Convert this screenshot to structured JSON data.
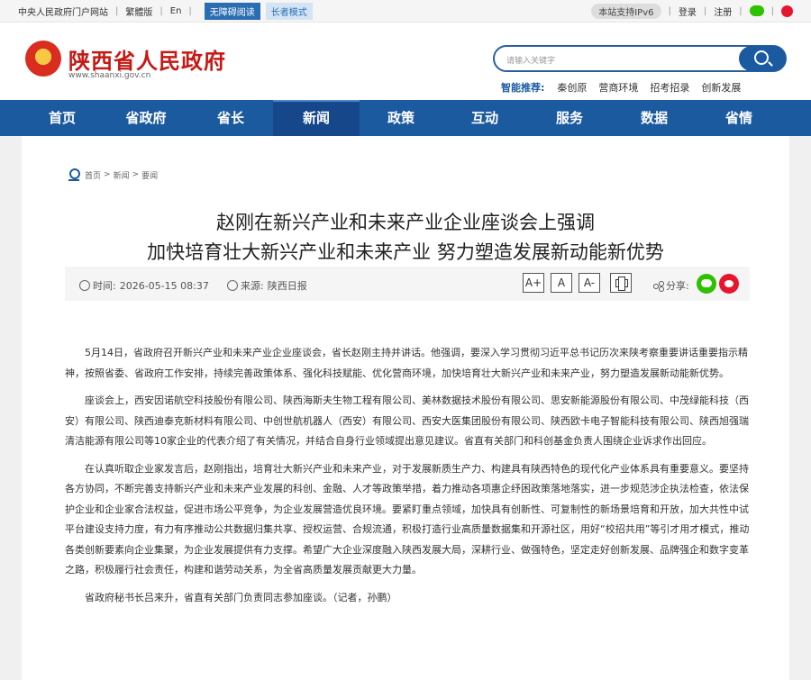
{
  "topbar": {
    "links": [
      "中央人民政府门户网站",
      "繁體版",
      "En"
    ],
    "accessible": "无障碍阅读",
    "elder": "长者模式",
    "ipv6": "本站支持IPv6",
    "login": "登录",
    "register": "注册"
  },
  "header": {
    "title": "陕西省人民政府",
    "url": "www.shaanxi.gov.cn",
    "search_placeholder": "请输入关键字",
    "smart_label": "智能推荐:",
    "smart_items": [
      "秦创原",
      "营商环境",
      "招考招录",
      "创新发展"
    ]
  },
  "nav": [
    "首页",
    "省政府",
    "省长",
    "新闻",
    "政策",
    "互动",
    "服务",
    "数据",
    "省情"
  ],
  "breadcrumb": [
    "首页",
    "新闻",
    "要闻"
  ],
  "article": {
    "title_line1": "赵刚在新兴产业和未来产业企业座谈会上强调",
    "title_line2": "加快培育壮大新兴产业和未来产业 努力塑造发展新动能新优势",
    "time_label": "时间:",
    "time": "2026-05-15 08:37",
    "source_label": "来源:",
    "source": "陕西日报",
    "font_buttons": [
      "A+",
      "A",
      "A-"
    ],
    "share_label": "分享:",
    "paragraphs": [
      "5月14日，省政府召开新兴产业和未来产业企业座谈会，省长赵刚主持并讲话。他强调，要深入学习贯彻习近平总书记历次来陕考察重要讲话重要指示精神，按照省委、省政府工作安排，持续完善政策体系、强化科技赋能、优化营商环境，加快培育壮大新兴产业和未来产业，努力塑造发展新动能新优势。",
      "座谈会上，西安因诺航空科技股份有限公司、陕西海斯夫生物工程有限公司、美林数据技术股份有限公司、思安新能源股份有限公司、中茂绿能科技（西安）有限公司、陕西迪泰克新材料有限公司、中创世航机器人（西安）有限公司、西安大医集团股份有限公司、陕西欧卡电子智能科技有限公司、陕西旭强瑞清洁能源有限公司等10家企业的代表介绍了有关情况，并结合自身行业领域提出意见建议。省直有关部门和科创基金负责人围绕企业诉求作出回应。",
      "在认真听取企业家发言后，赵刚指出，培育壮大新兴产业和未来产业，对于发展新质生产力、构建具有陕西特色的现代化产业体系具有重要意义。要坚持各方协同，不断完善支持新兴产业和未来产业发展的科创、金融、人才等政策举措，着力推动各项惠企纾困政策落地落实，进一步规范涉企执法检查，依法保护企业和企业家合法权益，促进市场公平竞争，为企业发展营造优良环境。要紧盯重点领域，加快具有创新性、可复制性的新场景培育和开放，加大共性中试平台建设支持力度，有力有序推动公共数据归集共享、授权运营、合规流通，积极打造行业高质量数据集和开源社区，用好“校招共用”等引才用才模式，推动各类创新要素向企业集聚，为企业发展提供有力支撑。希望广大企业深度融入陕西发展大局，深耕行业、做强特色，坚定走好创新发展、品牌强企和数字变革之路，积极履行社会责任，构建和谐劳动关系，为全省高质量发展贡献更大力量。",
      "省政府秘书长吕来升，省直有关部门负责同志参加座谈。（记者，孙鹏）"
    ]
  },
  "colors": {
    "nav_bg": "#1c5aa0",
    "title_red": "#c41a15",
    "accent_blue": "#1b5aa0"
  }
}
